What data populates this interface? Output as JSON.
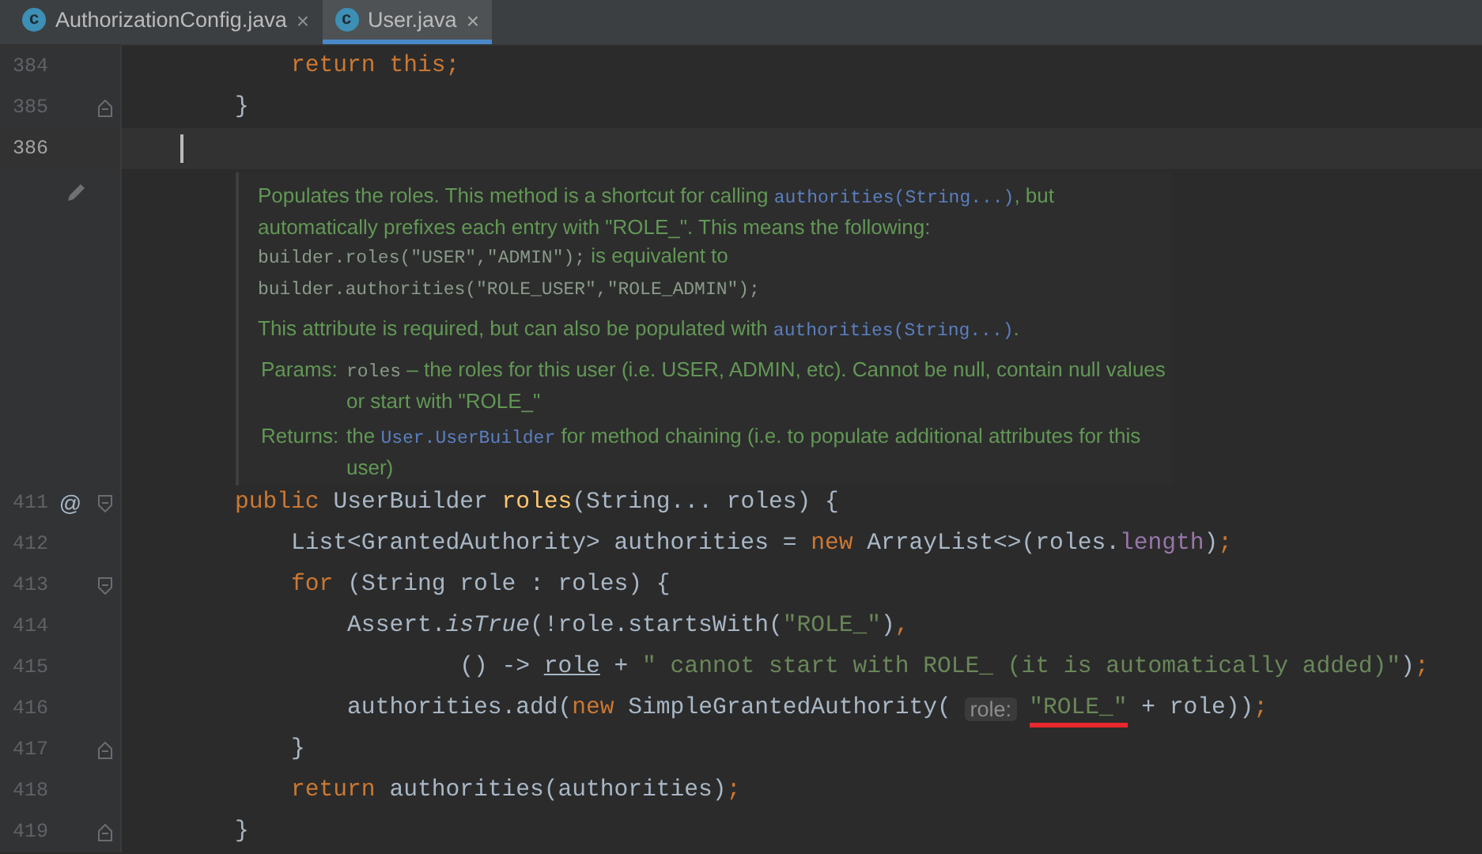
{
  "tabs": [
    {
      "icon_letter": "c",
      "label": "AuthorizationConfig.java",
      "close": "×",
      "selected": false
    },
    {
      "icon_letter": "c",
      "label": "User.java",
      "close": "×",
      "selected": true
    }
  ],
  "lines_before": [
    {
      "number": "384",
      "current": false,
      "tokens": [
        {
          "kind": "keyword",
          "text": "        return this"
        },
        {
          "kind": "keyword",
          "text": ";"
        }
      ]
    },
    {
      "number": "385",
      "fold_end": true,
      "current": false,
      "tokens": [
        {
          "kind": "plain",
          "text": "    }"
        }
      ]
    },
    {
      "number": "386",
      "current": true
    }
  ],
  "doc": {
    "paragraphs": [
      [
        {
          "kind": "text",
          "text": "Populates the roles. This method is a shortcut for calling "
        },
        {
          "kind": "link",
          "text": "authorities(String...)"
        },
        {
          "kind": "text",
          "text": ", but automatically prefixes each entry with \"ROLE_\". This means the following: "
        },
        {
          "kind": "code",
          "text": "builder.roles(\"USER\",\"ADMIN\");"
        },
        {
          "kind": "text",
          "text": " is equivalent to "
        },
        {
          "kind": "code",
          "text": "builder.authorities(\"ROLE_USER\",\"ROLE_ADMIN\");"
        }
      ],
      [
        {
          "kind": "text",
          "text": "This attribute is required, but can also be populated with "
        },
        {
          "kind": "link",
          "text": "authorities(String...)"
        },
        {
          "kind": "text",
          "text": "."
        }
      ]
    ],
    "tags": [
      {
        "label": "Params:",
        "body": [
          {
            "kind": "code",
            "text": "roles"
          },
          {
            "kind": "text",
            "text": " – the roles for this user (i.e. USER, ADMIN, etc). Cannot be null, contain null values or start with \"ROLE_\""
          }
        ]
      },
      {
        "label": "Returns:",
        "body": [
          {
            "kind": "text",
            "text": "the "
          },
          {
            "kind": "link",
            "text": "User.UserBuilder"
          },
          {
            "kind": "text",
            "text": " for method chaining (i.e. to populate additional attributes for this user)"
          }
        ]
      }
    ]
  },
  "lines_after": [
    {
      "number": "411",
      "marker": "@",
      "fold_start": true,
      "current": false,
      "tokens": [
        {
          "kind": "keyword",
          "text": "    public "
        },
        {
          "kind": "plain",
          "text": "UserBuilder "
        },
        {
          "kind": "declaration",
          "text": "roles"
        },
        {
          "kind": "plain",
          "text": "(String... roles) {"
        }
      ]
    },
    {
      "number": "412",
      "current": false,
      "tokens": [
        {
          "kind": "plain",
          "text": "        List<GrantedAuthority> authorities = "
        },
        {
          "kind": "keyword",
          "text": "new "
        },
        {
          "kind": "plain",
          "text": "ArrayList<>(roles."
        },
        {
          "kind": "field",
          "text": "length"
        },
        {
          "kind": "plain",
          "text": ")"
        },
        {
          "kind": "keyword",
          "text": ";"
        }
      ]
    },
    {
      "number": "413",
      "fold_start": true,
      "current": false,
      "tokens": [
        {
          "kind": "keyword",
          "text": "        for "
        },
        {
          "kind": "plain",
          "text": "(String role : roles) {"
        }
      ]
    },
    {
      "number": "414",
      "current": false,
      "tokens": [
        {
          "kind": "plain",
          "text": "            Assert."
        },
        {
          "kind": "static",
          "text": "isTrue"
        },
        {
          "kind": "plain",
          "text": "(!role.startsWith("
        },
        {
          "kind": "string",
          "text": "\"ROLE_\""
        },
        {
          "kind": "plain",
          "text": ")"
        },
        {
          "kind": "keyword",
          "text": ","
        }
      ]
    },
    {
      "number": "415",
      "current": false,
      "tokens": [
        {
          "kind": "plain",
          "text": "                    () -> "
        },
        {
          "kind": "underlined",
          "text": "role"
        },
        {
          "kind": "plain",
          "text": " + "
        },
        {
          "kind": "string",
          "text": "\" cannot start with ROLE_ (it is automatically added)\""
        },
        {
          "kind": "plain",
          "text": ")"
        },
        {
          "kind": "keyword",
          "text": ";"
        }
      ]
    },
    {
      "number": "416",
      "current": false,
      "tokens": [
        {
          "kind": "plain",
          "text": "            authorities.add("
        },
        {
          "kind": "keyword",
          "text": "new "
        },
        {
          "kind": "plain",
          "text": "SimpleGrantedAuthority( "
        },
        {
          "kind": "hint",
          "text": "role:"
        },
        {
          "kind": "string",
          "text": "\"ROLE_\"",
          "marked": true
        },
        {
          "kind": "plain",
          "text": " + role))"
        },
        {
          "kind": "keyword",
          "text": ";"
        }
      ]
    },
    {
      "number": "417",
      "fold_end": true,
      "current": false,
      "tokens": [
        {
          "kind": "plain",
          "text": "        }"
        }
      ]
    },
    {
      "number": "418",
      "current": false,
      "tokens": [
        {
          "kind": "keyword",
          "text": "        return "
        },
        {
          "kind": "plain",
          "text": "authorities(authorities)"
        },
        {
          "kind": "keyword",
          "text": ";"
        }
      ]
    },
    {
      "number": "419",
      "fold_end": true,
      "current": false,
      "tokens": [
        {
          "kind": "plain",
          "text": "    }"
        }
      ]
    }
  ]
}
